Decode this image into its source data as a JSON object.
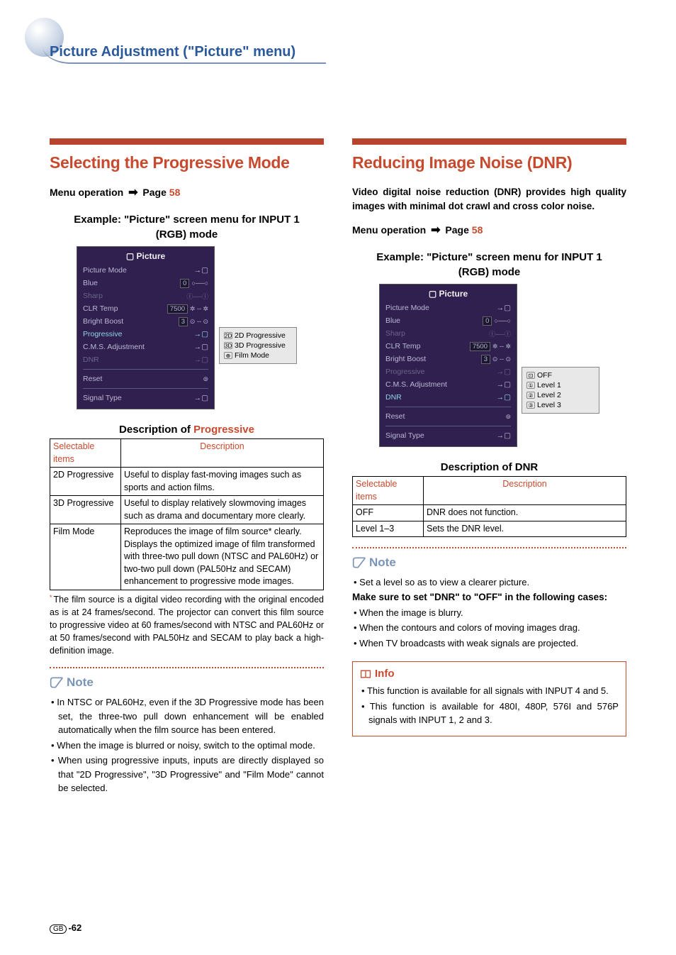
{
  "header_title": "Picture Adjustment (\"Picture\" menu)",
  "left": {
    "section_title": "Selecting the Progressive Mode",
    "menu_op_prefix": "Menu operation",
    "menu_op_page_label": "Page",
    "menu_op_page_num": "58",
    "example_label": "Example: \"Picture\" screen menu for INPUT 1 (RGB) mode",
    "osd": {
      "title": "Picture",
      "rows": [
        {
          "label": "Picture Mode",
          "arrow": "→",
          "knob": "",
          "box": "",
          "dim": false,
          "hl": false
        },
        {
          "label": "Blue",
          "arrow": "",
          "knob": "○──○",
          "box": "0",
          "dim": false,
          "hl": false
        },
        {
          "label": "Sharp",
          "arrow": "",
          "knob": "Ⓘ──Ⓘ",
          "box": "",
          "dim": true,
          "hl": false
        },
        {
          "label": "CLR Temp",
          "arrow": "",
          "knob": "✲ -- ✲",
          "box": "7500",
          "dim": false,
          "hl": false
        },
        {
          "label": "Bright Boost",
          "arrow": "",
          "knob": "⊙ -- ⊙",
          "box": "3",
          "dim": false,
          "hl": false
        },
        {
          "label": "Progressive",
          "arrow": "→",
          "knob": "",
          "box": "",
          "dim": false,
          "hl": true
        },
        {
          "label": "C.M.S. Adjustment",
          "arrow": "→",
          "knob": "",
          "box": "",
          "dim": false,
          "hl": false
        },
        {
          "label": "DNR",
          "arrow": "→",
          "knob": "",
          "box": "",
          "dim": true,
          "hl": false
        },
        {
          "label": "Reset",
          "arrow": "",
          "knob": "⊚",
          "box": "",
          "dim": false,
          "hl": false
        },
        {
          "label": "Signal Type",
          "arrow": "→",
          "knob": "",
          "box": "",
          "dim": false,
          "hl": false
        }
      ]
    },
    "side_panel": [
      "2D Progressive",
      "3D Progressive",
      "Film Mode"
    ],
    "desc_heading_a": "Description of ",
    "desc_heading_b": "Progressive",
    "table": {
      "h1": "Selectable items",
      "h2": "Description",
      "rows": [
        {
          "a": "2D Progressive",
          "b": "Useful to display fast-moving images such as sports and action films."
        },
        {
          "a": "3D Progressive",
          "b": "Useful to display relatively slowmoving images such as drama and documentary more clearly."
        },
        {
          "a": "Film Mode",
          "b": "Reproduces the image of film source* clearly. Displays the optimized image of film transformed with three-two pull down (NTSC and PAL60Hz) or two-two pull down (PAL50Hz and SECAM) enhancement to progressive mode images."
        }
      ]
    },
    "footnote": "The film source is a digital video recording with the original encoded as is at 24 frames/second. The projector can convert this film source to progressive video at 60 frames/second with NTSC and PAL60Hz or at 50 frames/second with PAL50Hz and SECAM to play back a high-definition image.",
    "note_label": "Note",
    "notes": [
      "In NTSC or PAL60Hz, even if the 3D Progressive mode has been set, the three-two pull down enhancement will be enabled automatically when the film source has been entered.",
      "When the image is blurred or noisy, switch to the optimal mode.",
      "When using progressive inputs, inputs are directly displayed so that \"2D Progressive\", \"3D Progressive\" and \"Film Mode\" cannot be selected."
    ]
  },
  "right": {
    "section_title": "Reducing Image Noise (DNR)",
    "intro": "Video digital noise reduction (DNR) provides high quality images with minimal dot crawl and cross color noise.",
    "menu_op_prefix": "Menu operation",
    "menu_op_page_label": "Page",
    "menu_op_page_num": "58",
    "example_label": "Example: \"Picture\" screen menu for INPUT 1 (RGB) mode",
    "osd": {
      "title": "Picture",
      "rows": [
        {
          "label": "Picture Mode",
          "arrow": "→",
          "knob": "",
          "box": "",
          "dim": false,
          "hl": false
        },
        {
          "label": "Blue",
          "arrow": "",
          "knob": "○──○",
          "box": "0",
          "dim": false,
          "hl": false
        },
        {
          "label": "Sharp",
          "arrow": "",
          "knob": "Ⓘ──Ⓘ",
          "box": "",
          "dim": true,
          "hl": false
        },
        {
          "label": "CLR Temp",
          "arrow": "",
          "knob": "✲ -- ✲",
          "box": "7500",
          "dim": false,
          "hl": false
        },
        {
          "label": "Bright Boost",
          "arrow": "",
          "knob": "⊙ -- ⊙",
          "box": "3",
          "dim": false,
          "hl": false
        },
        {
          "label": "Progressive",
          "arrow": "→",
          "knob": "",
          "box": "",
          "dim": true,
          "hl": false
        },
        {
          "label": "C.M.S. Adjustment",
          "arrow": "→",
          "knob": "",
          "box": "",
          "dim": false,
          "hl": false
        },
        {
          "label": "DNR",
          "arrow": "→",
          "knob": "",
          "box": "",
          "dim": false,
          "hl": true
        },
        {
          "label": "Reset",
          "arrow": "",
          "knob": "⊚",
          "box": "",
          "dim": false,
          "hl": false
        },
        {
          "label": "Signal Type",
          "arrow": "→",
          "knob": "",
          "box": "",
          "dim": false,
          "hl": false
        }
      ]
    },
    "side_panel": [
      "OFF",
      "Level 1",
      "Level 2",
      "Level 3"
    ],
    "desc_heading": "Description of DNR",
    "table": {
      "h1": "Selectable items",
      "h2": "Description",
      "rows": [
        {
          "a": "OFF",
          "b": "DNR does not function."
        },
        {
          "a": "Level 1–3",
          "b": "Sets the DNR level."
        }
      ]
    },
    "note_label": "Note",
    "note_intro": "Set a level so as to view a clearer picture.",
    "note_bold": "Make sure to set \"DNR\" to \"OFF\" in the following cases:",
    "notes": [
      "When the image is blurry.",
      "When the contours and colors of moving images drag.",
      "When TV broadcasts with weak signals are projected."
    ],
    "info_label": "Info",
    "info": [
      "This function is available for all signals with INPUT 4 and 5.",
      "This function is available for 480I, 480P, 576I and 576P signals with INPUT 1, 2 and 3."
    ]
  },
  "footer": {
    "badge": "GB",
    "page": "-62"
  }
}
